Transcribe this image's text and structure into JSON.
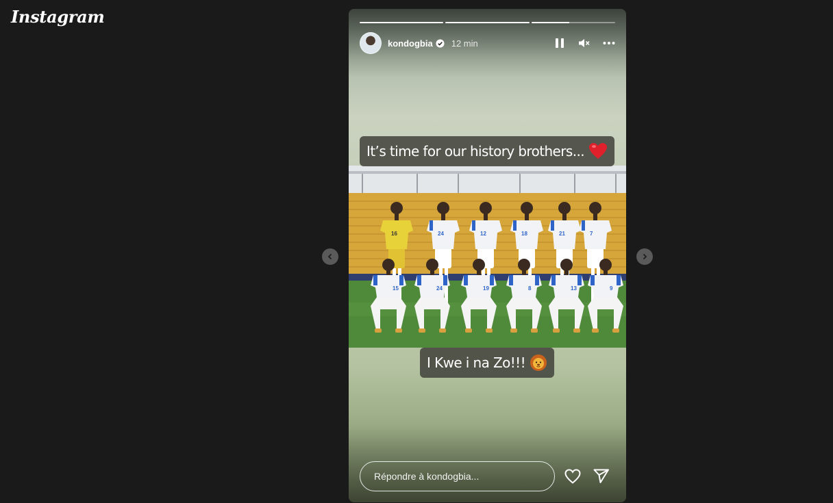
{
  "app": {
    "logo_text": "Instagram"
  },
  "story": {
    "progress": [
      1.0,
      1.0,
      0.45
    ],
    "username": "kondogbia",
    "verified": true,
    "time_ago": "12 min",
    "captions": [
      {
        "text": "It’s time for our history brothers...",
        "emoji": "heart-emoji"
      },
      {
        "text": "I Kwe i na Zo!!!",
        "emoji": "lion-emoji"
      }
    ],
    "photo": {
      "description_icon": "team-photo",
      "back_row_numbers": [
        "16",
        "24",
        "12",
        "18",
        "21",
        "7"
      ],
      "front_row_numbers": [
        "15",
        "24",
        "19",
        "8",
        "13",
        "9"
      ],
      "colors": {
        "goalkeeper": "#e8d23a",
        "kit": "#f1f3f6",
        "kit_accent": "#2e64c8",
        "pitch": "#4f8a3a",
        "stands": "#d9a93a"
      }
    },
    "controls": {
      "pause_icon": "pause-icon",
      "mute_icon": "muted-speaker-icon",
      "more_icon": "more-icon"
    }
  },
  "reply": {
    "placeholder": "Répondre à kondogbia...",
    "like_icon": "heart-icon",
    "send_icon": "send-icon"
  },
  "nav": {
    "prev_icon": "chevron-left-icon",
    "next_icon": "chevron-right-icon"
  }
}
